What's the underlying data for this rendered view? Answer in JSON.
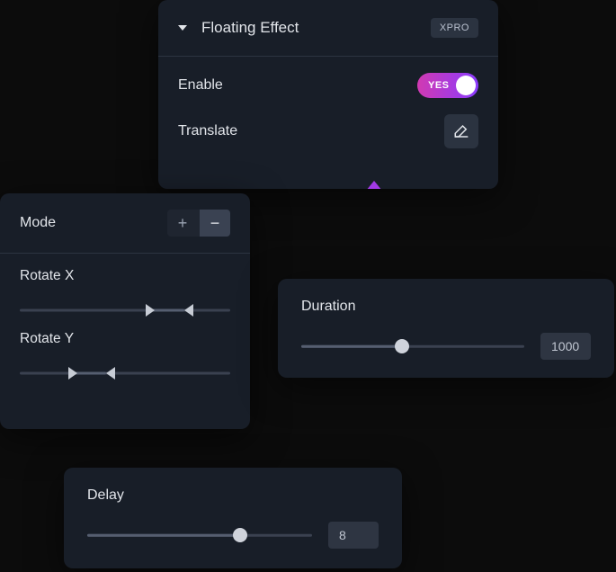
{
  "floating": {
    "title": "Floating Effect",
    "badge": "XPRO",
    "enable_label": "Enable",
    "toggle_state": "YES",
    "translate_label": "Translate"
  },
  "mode_panel": {
    "title": "Mode",
    "plus": "+",
    "minus": "−",
    "rotate_x_label": "Rotate X",
    "rotate_x": {
      "low_pct": 60,
      "high_pct": 78
    },
    "rotate_y_label": "Rotate Y",
    "rotate_y": {
      "low_pct": 23,
      "high_pct": 41
    }
  },
  "duration_panel": {
    "label": "Duration",
    "value": "1000",
    "fill_pct": 45
  },
  "delay_panel": {
    "label": "Delay",
    "value": "8",
    "fill_pct": 68
  },
  "colors": {
    "panel_bg": "#181e28",
    "accent_gradient_start": "#d13ab2",
    "accent_gradient_end": "#8a3bff"
  }
}
